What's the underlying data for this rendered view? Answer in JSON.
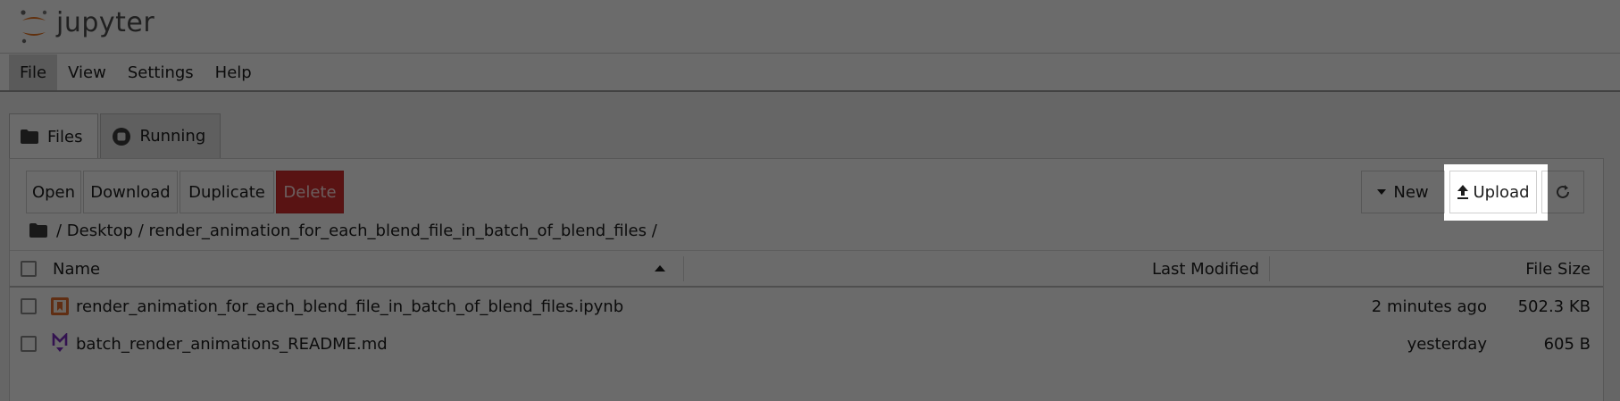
{
  "header": {
    "brand": "jupyter",
    "logo_icon": "jupyter-logo-icon"
  },
  "menu": {
    "items": [
      {
        "label": "File",
        "active": true
      },
      {
        "label": "View"
      },
      {
        "label": "Settings"
      },
      {
        "label": "Help"
      }
    ]
  },
  "tabs": [
    {
      "label": "Files",
      "icon": "folder-icon",
      "active": true
    },
    {
      "label": "Running",
      "icon": "stop-circle-icon"
    }
  ],
  "toolbar": {
    "open_label": "Open",
    "download_label": "Download",
    "duplicate_label": "Duplicate",
    "delete_label": "Delete",
    "new_label": "New",
    "upload_label": "Upload",
    "refresh_icon": "refresh-icon",
    "accent_danger": "#d32f2f"
  },
  "breadcrumb": {
    "text": "/ Desktop / render_animation_for_each_blend_file_in_batch_of_blend_files /"
  },
  "table": {
    "columns": {
      "name": "Name",
      "modified": "Last Modified",
      "size": "File Size"
    },
    "rows": [
      {
        "name": "render_animation_for_each_blend_file_in_batch_of_blend_files.ipynb",
        "icon": "notebook-icon",
        "modified": "2 minutes ago",
        "size": "502.3 KB"
      },
      {
        "name": "batch_render_animations_README.md",
        "icon": "markdown-icon",
        "modified": "yesterday",
        "size": "605 B"
      }
    ]
  }
}
